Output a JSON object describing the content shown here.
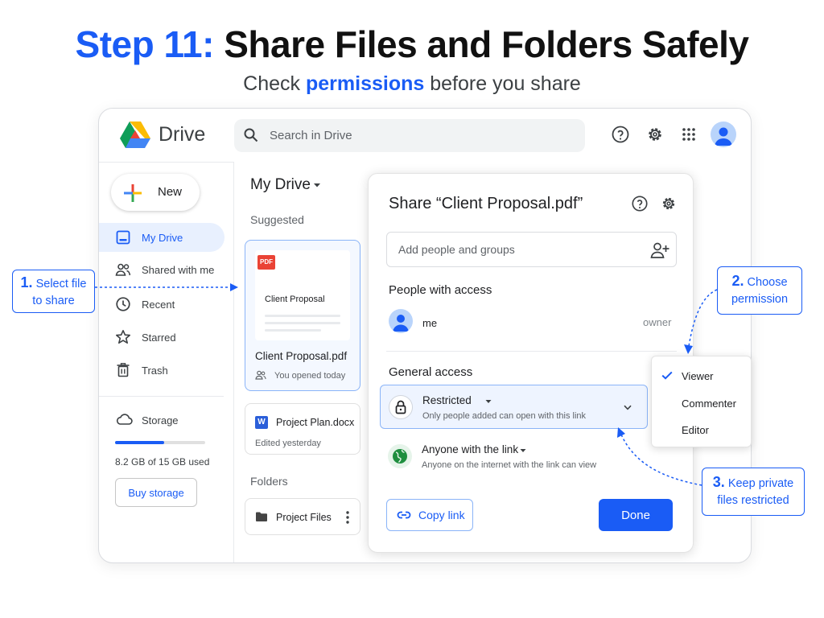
{
  "heading": {
    "step": "Step 11:",
    "title": "Share Files and Folders Safely",
    "subtitle_pre": "Check",
    "subtitle_highlight": "permissions",
    "subtitle_post": "before you share"
  },
  "app": {
    "brand": "Drive",
    "search_placeholder": "Search in Drive"
  },
  "sidebar": {
    "new_label": "New",
    "items": [
      {
        "label": "My Drive",
        "icon": "my-drive-icon",
        "active": true
      },
      {
        "label": "Shared with me",
        "icon": "people-icon"
      },
      {
        "label": "Recent",
        "icon": "clock-icon"
      },
      {
        "label": "Starred",
        "icon": "star-icon"
      },
      {
        "label": "Trash",
        "icon": "trash-icon"
      }
    ],
    "storage_label": "Storage",
    "storage_text": "8.2 GB of 15 GB used",
    "storage_used_fraction": 0.547,
    "buy_label": "Buy storage"
  },
  "main": {
    "title": "My Drive",
    "suggested_label": "Suggested",
    "pdf_badge": "PDF",
    "preview_title": "Client Proposal",
    "file_name": "Client Proposal.pdf",
    "file_meta": "You opened today",
    "doc_badge": "W",
    "doc_name": "Project Plan.docx",
    "doc_meta": "Edited yesterday",
    "folders_label": "Folders",
    "folder_name": "Project Files"
  },
  "share": {
    "title": "Share “Client Proposal.pdf”",
    "add_placeholder": "Add people and groups",
    "people_label": "People with access",
    "person_name": "me",
    "person_role": "owner",
    "general_label": "General access",
    "restricted_title": "Restricted",
    "restricted_desc": "Only people added can open with this link",
    "anyone_title": "Anyone with the link",
    "anyone_desc": "Anyone on the internet with the link can view",
    "copy_label": "Copy link",
    "done_label": "Done"
  },
  "permission_menu": {
    "items": [
      "Viewer",
      "Commenter",
      "Editor"
    ],
    "selected": "Viewer"
  },
  "callouts": {
    "c1_num": "1.",
    "c1_line1": "Select file",
    "c1_line2": "to share",
    "c2_num": "2.",
    "c2_line1": "Choose",
    "c2_line2": "permission",
    "c3_num": "3.",
    "c3_line1": "Keep private",
    "c3_line2": "files restricted"
  },
  "colors": {
    "accent": "#1a5cf5",
    "selected_bg": "#e8f0fe",
    "pdf_red": "#ea4335"
  }
}
